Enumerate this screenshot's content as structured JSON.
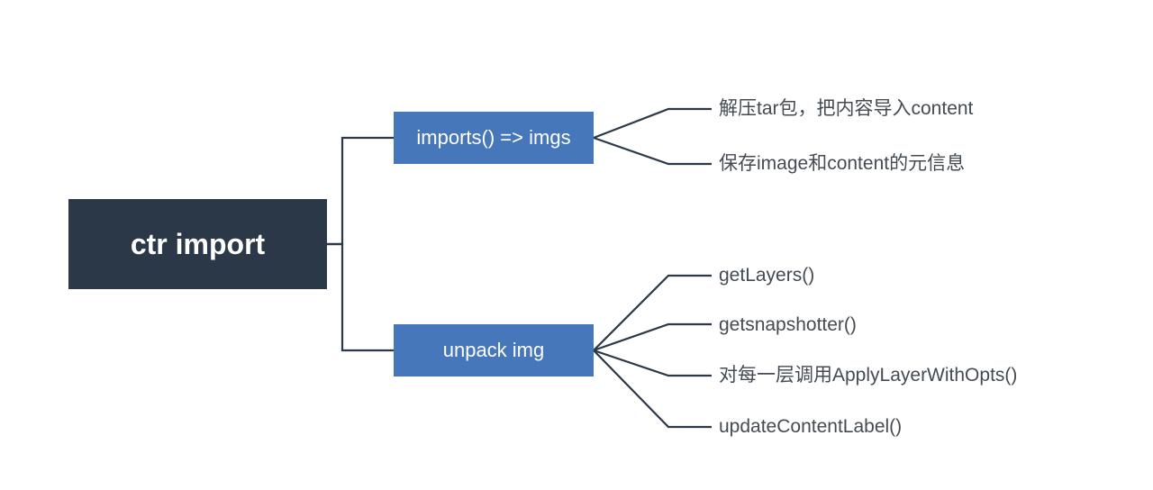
{
  "root": {
    "label": "ctr import"
  },
  "mid": {
    "imports": {
      "label": "imports()  => imgs"
    },
    "unpack": {
      "label": "unpack img"
    }
  },
  "leaves": {
    "imports": [
      "解压tar包，把内容导入content",
      "保存image和content的元信息"
    ],
    "unpack": [
      "getLayers()",
      "getsnapshotter()",
      "对每一层调用ApplyLayerWithOpts()",
      "updateContentLabel()"
    ]
  },
  "colors": {
    "root_bg": "#2b3847",
    "mid_bg": "#4777bb",
    "line": "#2b3847",
    "text": "#444b52"
  }
}
